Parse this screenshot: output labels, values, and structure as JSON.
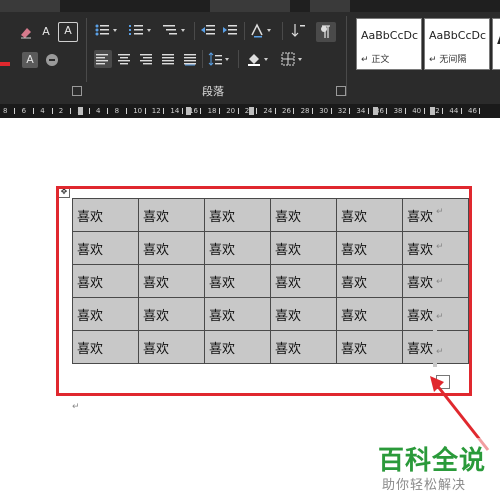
{
  "ribbon": {
    "paragraph_group_label": "段落",
    "font_group_buttons": [
      "A",
      "A",
      "A"
    ],
    "styles": [
      {
        "sample": "AaBbCcDc",
        "name": "↵ 正文"
      },
      {
        "sample": "AaBbCcDc",
        "name": "↵ 无间隔"
      },
      {
        "sample": "A",
        "name": ""
      }
    ]
  },
  "ruler": {
    "labels": [
      "8",
      "6",
      "4",
      "2",
      "2",
      "4",
      "8",
      "10",
      "12",
      "14",
      "16",
      "18",
      "20",
      "22",
      "24",
      "26",
      "28",
      "30",
      "32",
      "34",
      "36",
      "38",
      "40",
      "42",
      "44",
      "46"
    ]
  },
  "document": {
    "table": {
      "rows": [
        [
          "喜欢",
          "喜欢",
          "喜欢",
          "喜欢",
          "喜欢",
          "喜欢"
        ],
        [
          "喜欢",
          "喜欢",
          "喜欢",
          "喜欢",
          "喜欢",
          "喜欢"
        ],
        [
          "喜欢",
          "喜欢",
          "喜欢",
          "喜欢",
          "喜欢",
          "喜欢"
        ],
        [
          "喜欢",
          "喜欢",
          "喜欢",
          "喜欢",
          "喜欢",
          "喜欢"
        ],
        [
          "喜欢",
          "喜欢",
          "喜欢",
          "喜欢",
          "喜欢",
          "喜欢"
        ]
      ],
      "cell_color": "#c8c8c8",
      "border_color": "#4a4a4a"
    },
    "move_handle_glyph": "✥",
    "paragraph_mark": "↵"
  },
  "annotation": {
    "box_color": "#e0282e",
    "arrow_color": "#e0282e"
  },
  "watermark": {
    "title": "百科全说",
    "subtitle": "助你轻松解决",
    "title_color": "#2a9a3a"
  },
  "colors": {
    "ribbon_bg": "#2b2b2b",
    "ruler_bg": "#1a1a1a"
  }
}
